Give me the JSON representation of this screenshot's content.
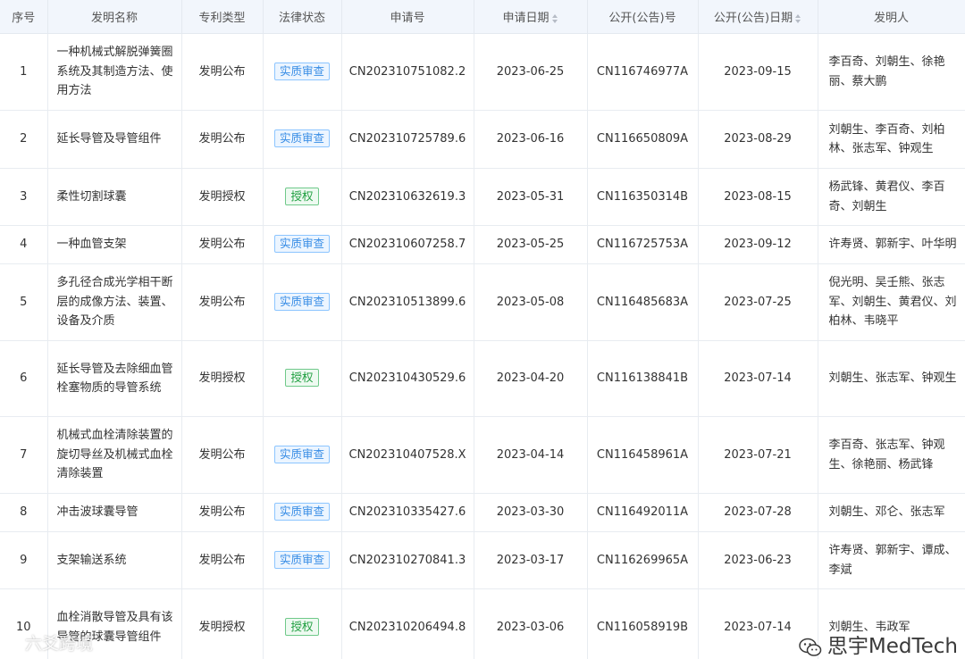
{
  "headers": [
    "序号",
    "发明名称",
    "专利类型",
    "法律状态",
    "申请号",
    "申请日期",
    "公开(公告)号",
    "公开(公告)日期",
    "发明人"
  ],
  "colors": {
    "header_bg": "#f2f6fc",
    "status_review": "#3a8ee6",
    "status_granted": "#1e9e3f"
  },
  "rows": [
    {
      "idx": "1",
      "name": "一种机械式解脱弹簧圈系统及其制造方法、使用方法",
      "type": "发明公布",
      "status": "实质审查",
      "app_no": "CN202310751082.2",
      "app_date": "2023-06-25",
      "pub_no": "CN116746977A",
      "pub_date": "2023-09-15",
      "inventors": "李百奇、刘朝生、徐艳丽、蔡大鹏"
    },
    {
      "idx": "2",
      "name": "延长导管及导管组件",
      "type": "发明公布",
      "status": "实质审查",
      "app_no": "CN202310725789.6",
      "app_date": "2023-06-16",
      "pub_no": "CN116650809A",
      "pub_date": "2023-08-29",
      "inventors": "刘朝生、李百奇、刘柏林、张志军、钟观生"
    },
    {
      "idx": "3",
      "name": "柔性切割球囊",
      "type": "发明授权",
      "status": "授权",
      "app_no": "CN202310632619.3",
      "app_date": "2023-05-31",
      "pub_no": "CN116350314B",
      "pub_date": "2023-08-15",
      "inventors": "杨武锋、黄君仪、李百奇、刘朝生"
    },
    {
      "idx": "4",
      "name": "一种血管支架",
      "type": "发明公布",
      "status": "实质审查",
      "app_no": "CN202310607258.7",
      "app_date": "2023-05-25",
      "pub_no": "CN116725753A",
      "pub_date": "2023-09-12",
      "inventors": "许寿贤、郭新宇、叶华明"
    },
    {
      "idx": "5",
      "name": "多孔径合成光学相干断层的成像方法、装置、设备及介质",
      "type": "发明公布",
      "status": "实质审查",
      "app_no": "CN202310513899.6",
      "app_date": "2023-05-08",
      "pub_no": "CN116485683A",
      "pub_date": "2023-07-25",
      "inventors": "倪光明、吴壬熊、张志军、刘朝生、黄君仪、刘柏林、韦晓平"
    },
    {
      "idx": "6",
      "name": "延长导管及去除细血管栓塞物质的导管系统",
      "type": "发明授权",
      "status": "授权",
      "app_no": "CN202310430529.6",
      "app_date": "2023-04-20",
      "pub_no": "CN116138841B",
      "pub_date": "2023-07-14",
      "inventors": "刘朝生、张志军、钟观生"
    },
    {
      "idx": "7",
      "name": "机械式血栓清除装置的旋切导丝及机械式血栓清除装置",
      "type": "发明公布",
      "status": "实质审查",
      "app_no": "CN202310407528.X",
      "app_date": "2023-04-14",
      "pub_no": "CN116458961A",
      "pub_date": "2023-07-21",
      "inventors": "李百奇、张志军、钟观生、徐艳丽、杨武锋"
    },
    {
      "idx": "8",
      "name": "冲击波球囊导管",
      "type": "发明公布",
      "status": "实质审查",
      "app_no": "CN202310335427.6",
      "app_date": "2023-03-30",
      "pub_no": "CN116492011A",
      "pub_date": "2023-07-28",
      "inventors": "刘朝生、邓仑、张志军"
    },
    {
      "idx": "9",
      "name": "支架输送系统",
      "type": "发明公布",
      "status": "实质审查",
      "app_no": "CN202310270841.3",
      "app_date": "2023-03-17",
      "pub_no": "CN116269965A",
      "pub_date": "2023-06-23",
      "inventors": "许寿贤、郭新宇、谭成、李斌"
    },
    {
      "idx": "10",
      "name": "血栓消散导管及具有该导管的球囊导管组件",
      "type": "发明授权",
      "status": "授权",
      "app_no": "CN202310206494.8",
      "app_date": "2023-03-06",
      "pub_no": "CN116058919B",
      "pub_date": "2023-07-14",
      "inventors": "刘朝生、韦政军"
    }
  ],
  "watermarks": {
    "left": "六爻跨境",
    "right": "思宇MedTech"
  }
}
